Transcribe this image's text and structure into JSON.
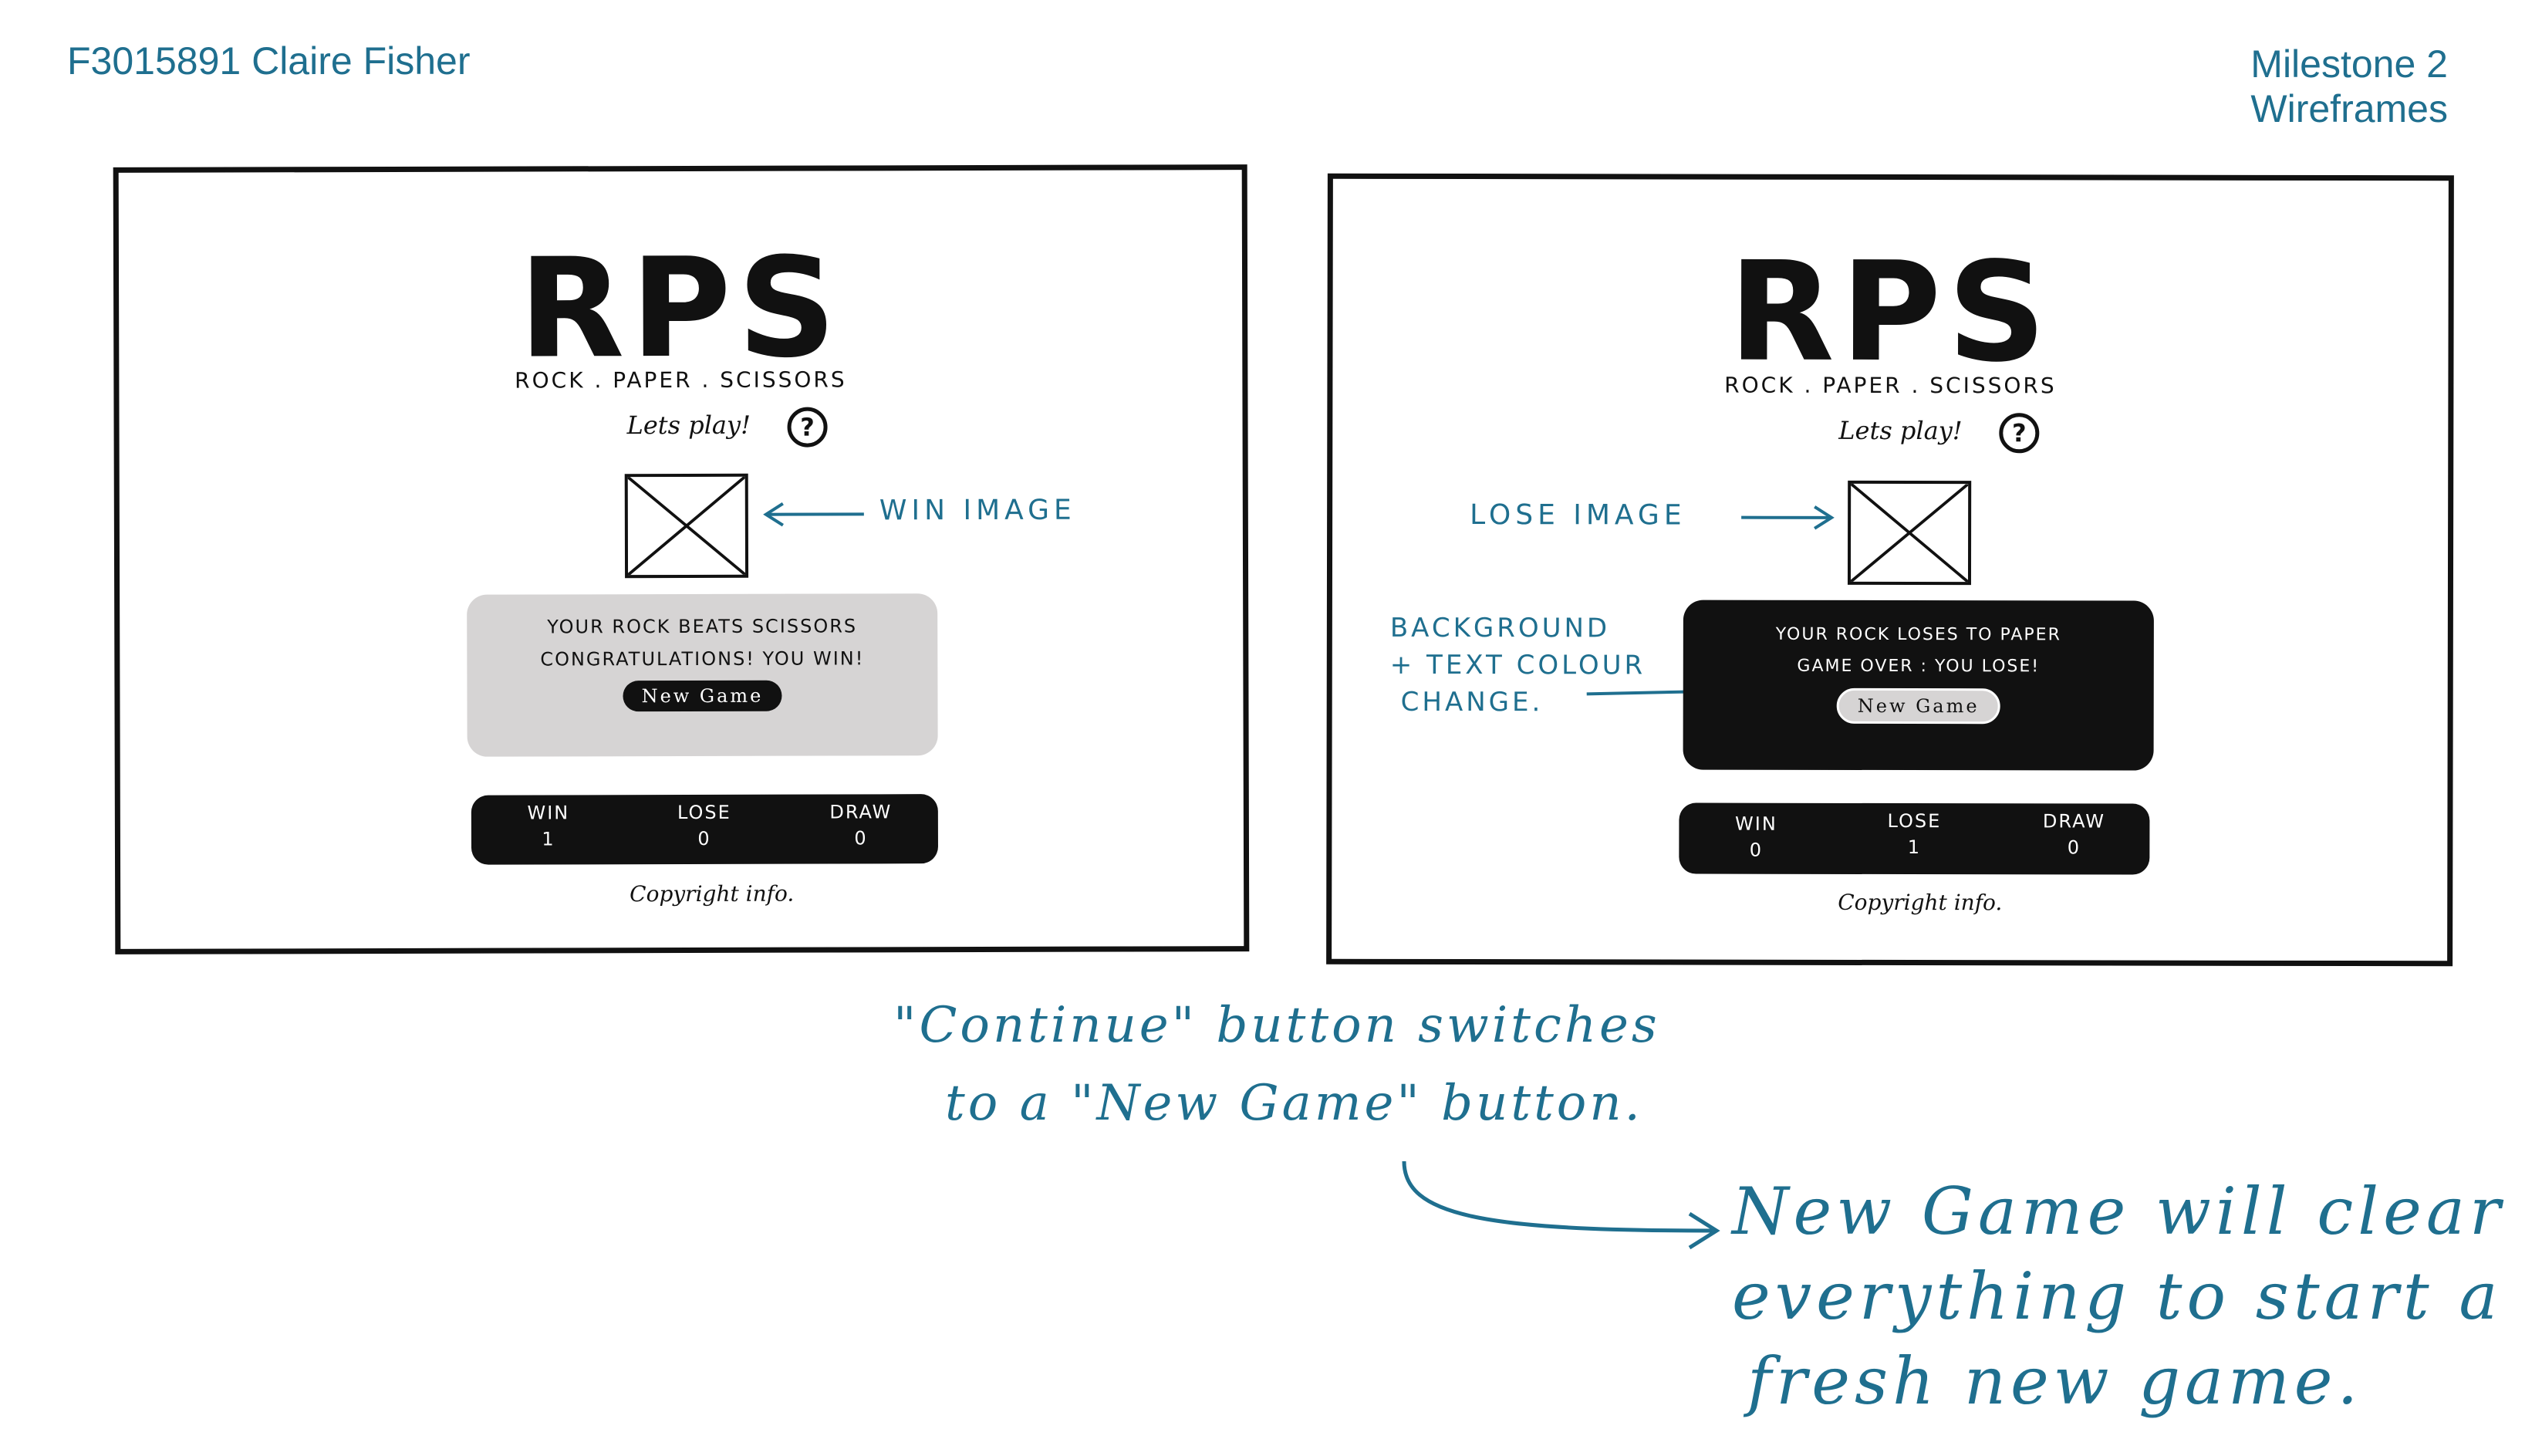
{
  "header": {
    "author": "F3015891 Claire Fisher",
    "milestone_line1": "Milestone 2",
    "milestone_line2": "Wireframes"
  },
  "win_screen": {
    "logo": "RPS",
    "subtitle": "ROCK . PAPER . SCISSORS",
    "lets_play": "Lets play!",
    "help_icon": "?",
    "image_label": "WIN IMAGE",
    "result_line1": "YOUR ROCK BEATS SCISSORS",
    "result_line2": "CONGRATULATIONS! YOU WIN!",
    "button": "New Game",
    "score": [
      {
        "label": "WIN",
        "value": "1"
      },
      {
        "label": "LOSE",
        "value": "0"
      },
      {
        "label": "DRAW",
        "value": "0"
      }
    ],
    "copyright": "Copyright info."
  },
  "lose_screen": {
    "logo": "RPS",
    "subtitle": "ROCK . PAPER . SCISSORS",
    "lets_play": "Lets play!",
    "help_icon": "?",
    "image_label": "LOSE IMAGE",
    "bg_note_line1": "BACKGROUND",
    "bg_note_line2": "+ TEXT COLOUR",
    "bg_note_line3": "CHANGE.",
    "result_line1": "YOUR ROCK LOSES TO PAPER",
    "result_line2": "GAME OVER : YOU LOSE!",
    "button": "New Game",
    "score": [
      {
        "label": "WIN",
        "value": "0"
      },
      {
        "label": "LOSE",
        "value": "1"
      },
      {
        "label": "DRAW",
        "value": "0"
      }
    ],
    "copyright": "Copyright info."
  },
  "notes": {
    "continue_line1": "\"Continue\" button switches",
    "continue_line2": "to a \"New Game\" button.",
    "newgame_line1": "New Game will clear",
    "newgame_line2": "everything to start a",
    "newgame_line3": "fresh new game."
  },
  "colors": {
    "annotation": "#1f6f8f",
    "win_panel": "#d6d4d4",
    "lose_panel": "#111111"
  },
  "icons": [
    "question-circle-icon",
    "image-placeholder-icon",
    "arrow-icon"
  ]
}
